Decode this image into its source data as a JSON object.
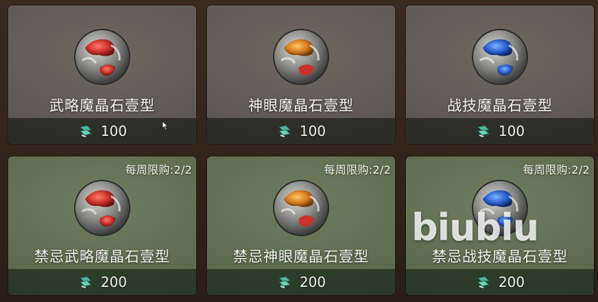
{
  "shop": {
    "items": [
      {
        "name": "武略魔晶石壹型",
        "price": "100",
        "limit": "",
        "gem_color": "red",
        "style": "gray"
      },
      {
        "name": "神眼魔晶石壹型",
        "price": "100",
        "limit": "",
        "gem_color": "orange",
        "style": "gray"
      },
      {
        "name": "战技魔晶石壹型",
        "price": "100",
        "limit": "",
        "gem_color": "blue",
        "style": "gray"
      },
      {
        "name": "禁忌武略魔晶石壹型",
        "price": "200",
        "limit": "每周限购:2/2",
        "gem_color": "red",
        "style": "green"
      },
      {
        "name": "禁忌神眼魔晶石壹型",
        "price": "200",
        "limit": "每周限购:2/2",
        "gem_color": "orange",
        "style": "green"
      },
      {
        "name": "禁忌战技魔晶石壹型",
        "price": "200",
        "limit": "每周限购:2/2",
        "gem_color": "blue",
        "style": "green"
      }
    ],
    "currency_icon": "scroll-ticket-icon"
  },
  "watermark": "biubiu",
  "colors": {
    "red_gem": "#c8322a",
    "orange_gem": "#d67a1c",
    "blue_gem": "#2a5fd0",
    "gray_card": "#5e5853",
    "green_card": "#5d6c4f",
    "currency": "#4fb8a0"
  }
}
